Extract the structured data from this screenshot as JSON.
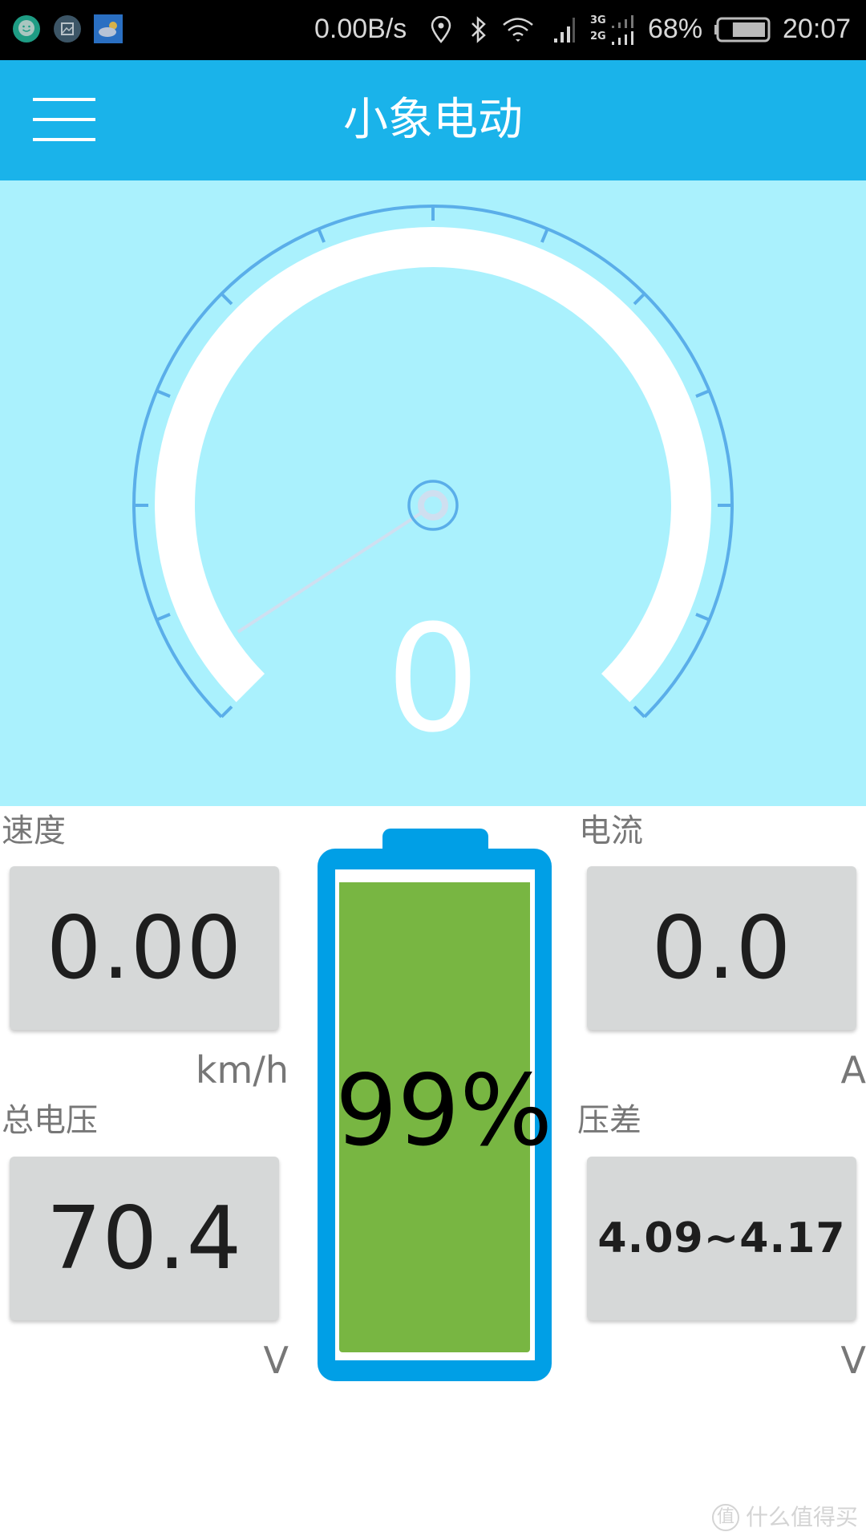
{
  "status_bar": {
    "network_speed": "0.00B/s",
    "network_labels": [
      "3G",
      "2G"
    ],
    "battery_percent": "68%",
    "battery_level": 0.68,
    "time": "20:07",
    "notification_icons": [
      "chat-bubble-icon",
      "screenshot-icon",
      "weather-icon"
    ],
    "system_icons": [
      "location-icon",
      "bluetooth-icon",
      "wifi-icon",
      "signal-icon",
      "dual-sim-signal-icon",
      "battery-icon"
    ]
  },
  "app_bar": {
    "title": "小象电动",
    "menu_icon": "hamburger-menu-icon"
  },
  "gauge": {
    "value_text": "0",
    "value": 0,
    "tick_count": 13,
    "colors": {
      "background": "#aaf1fd",
      "band": "#ffffff",
      "scale": "#5aaee9",
      "needle": "#cfdff0"
    }
  },
  "metrics": {
    "speed": {
      "label": "速度",
      "value": "0.00",
      "unit": "km/h"
    },
    "current": {
      "label": "电流",
      "value": "0.0",
      "unit": "A"
    },
    "total_voltage": {
      "label": "总电压",
      "value": "70.4",
      "unit": "V"
    },
    "voltage_diff": {
      "label": "压差",
      "value": "4.09~4.17",
      "unit": "V"
    }
  },
  "battery": {
    "percent_text": "99%",
    "level": 0.99,
    "colors": {
      "frame": "#009fe6",
      "fill": "#78b642"
    }
  },
  "watermark": {
    "badge": "值",
    "text": "什么值得买"
  }
}
